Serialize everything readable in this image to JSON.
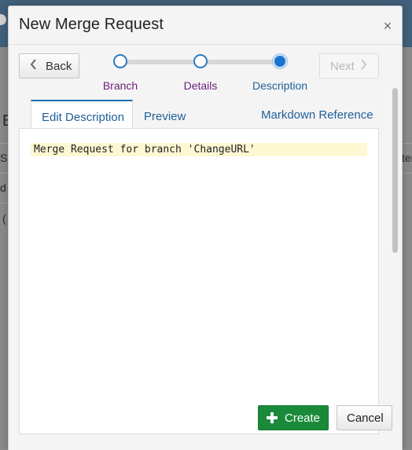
{
  "dialog": {
    "title": "New Merge Request",
    "close_glyph": "×"
  },
  "nav": {
    "back_label": "Back",
    "next_label": "Next",
    "back_icon": "chevron-left-icon",
    "next_icon": "chevron-right-icon"
  },
  "steps": [
    {
      "label": "Branch",
      "state": "completed"
    },
    {
      "label": "Details",
      "state": "completed"
    },
    {
      "label": "Description",
      "state": "active"
    }
  ],
  "tabs": {
    "edit_label": "Edit Description",
    "preview_label": "Preview",
    "markdown_reference_label": "Markdown Reference"
  },
  "editor": {
    "content": "Merge Request for branch 'ChangeURL'"
  },
  "footer": {
    "create_label": "Create",
    "create_icon": "plus-icon",
    "cancel_label": "Cancel"
  },
  "background_page": {
    "fragments": [
      "E",
      "S",
      "d",
      "(",
      "ter"
    ]
  },
  "colors": {
    "accent": "#1f5f99",
    "completed_step": "#6a1f7a",
    "create_button": "#1a8a3a",
    "editor_highlight": "#fdf7d2"
  }
}
